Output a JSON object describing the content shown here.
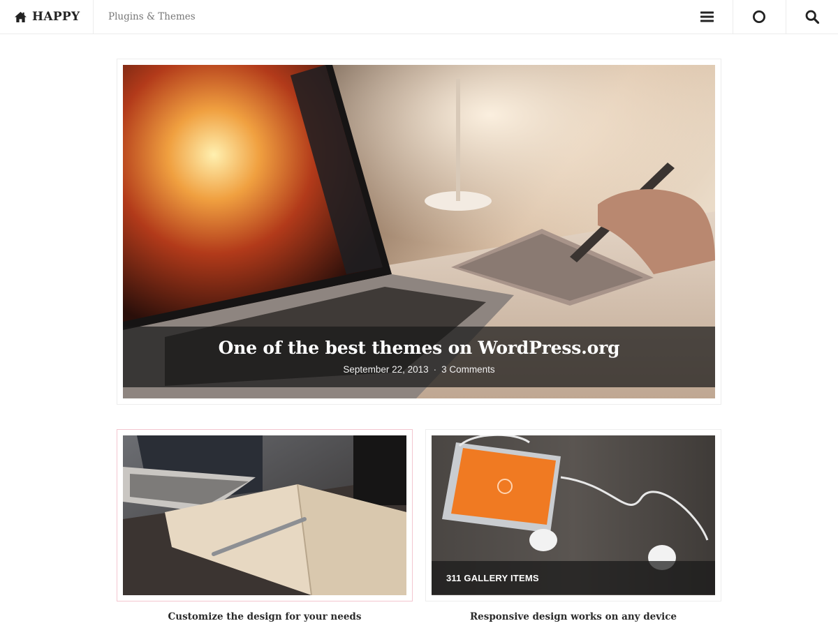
{
  "header": {
    "brand": "HAPPY",
    "nav_link": "Plugins & Themes",
    "icons": [
      "home-icon",
      "menu-icon",
      "circle-icon",
      "search-icon"
    ]
  },
  "featured": {
    "title": "One of the best themes on WordPress.org",
    "date": "September 22, 2013",
    "separator": "·",
    "comments": "3 Comments"
  },
  "cards": [
    {
      "title": "Customize the design for your needs",
      "badge": ""
    },
    {
      "title": "Responsive design works on any device",
      "badge": "311 GALLERY ITEMS"
    }
  ],
  "colors": {
    "text": "#222222",
    "muted": "#777777",
    "border": "#ededed",
    "active_border": "#f3c6cf",
    "caption_overlay": "rgba(25,25,25,0.72)"
  }
}
